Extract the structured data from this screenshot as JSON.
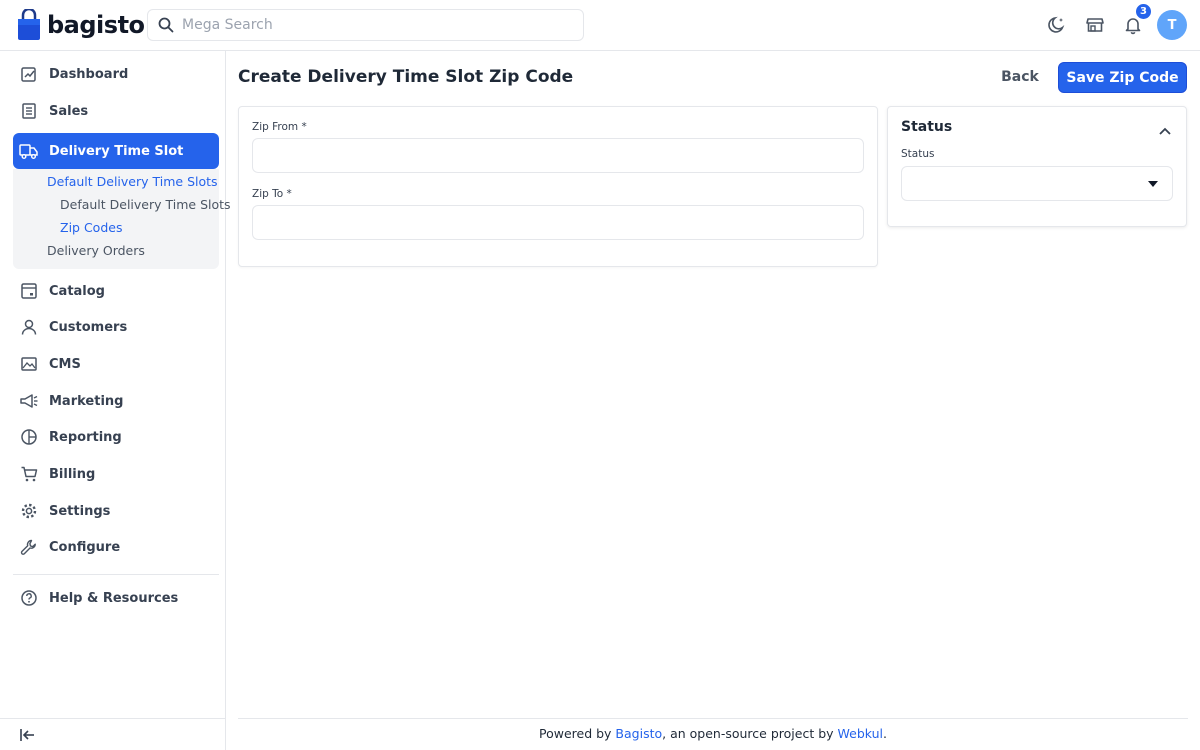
{
  "header": {
    "brand": "bagisto",
    "search_placeholder": "Mega Search",
    "notification_count": "3",
    "avatar_initial": "T"
  },
  "sidebar": {
    "items": [
      {
        "label": "Dashboard",
        "icon": "dashboard-icon"
      },
      {
        "label": "Sales",
        "icon": "receipt-icon"
      },
      {
        "label": "Delivery Time Slot",
        "icon": "delivery-truck-icon"
      },
      {
        "label": "Catalog",
        "icon": "catalog-icon"
      },
      {
        "label": "Customers",
        "icon": "user-icon"
      },
      {
        "label": "CMS",
        "icon": "image-icon"
      },
      {
        "label": "Marketing",
        "icon": "megaphone-icon"
      },
      {
        "label": "Reporting",
        "icon": "pie-chart-icon"
      },
      {
        "label": "Billing",
        "icon": "cart-icon"
      },
      {
        "label": "Settings",
        "icon": "gear-icon"
      },
      {
        "label": "Configure",
        "icon": "wrench-icon"
      },
      {
        "label": "Help & Resources",
        "icon": "help-icon"
      }
    ],
    "sub": {
      "parent": "Default Delivery Time Slots",
      "child1": "Default Delivery Time Slots",
      "child2": "Zip Codes",
      "other": "Delivery Orders"
    }
  },
  "main": {
    "title": "Create Delivery Time Slot Zip Code",
    "back_label": "Back",
    "save_label": "Save Zip Code",
    "zip_from_label": "Zip From *",
    "zip_from_value": "",
    "zip_to_label": "Zip To *",
    "zip_to_value": "",
    "status_title": "Status",
    "status_label": "Status",
    "status_value": ""
  },
  "footer": {
    "prefix": "Powered by ",
    "bagisto_link": "Bagisto",
    "middle": ", an open-source project by ",
    "webkul_link": "Webkul",
    "suffix": "."
  },
  "colors": {
    "accent": "#2563eb",
    "sub_bg": "#f3f4f6"
  }
}
